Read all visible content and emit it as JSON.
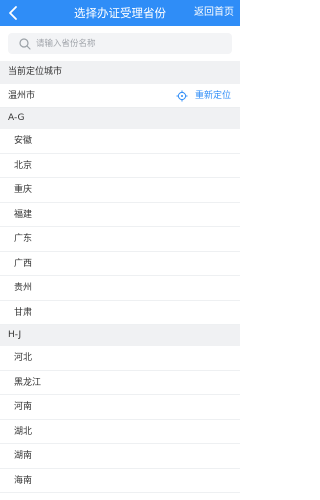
{
  "header": {
    "title": "选择办证受理省份",
    "home_label": "返回首页"
  },
  "search": {
    "placeholder": "请输入省份名称"
  },
  "location": {
    "section_title": "当前定位城市",
    "city": "温州市",
    "relocate_label": "重新定位"
  },
  "groups": [
    {
      "header": "A-G",
      "items": [
        "安徽",
        "北京",
        "重庆",
        "福建",
        "广东",
        "广西",
        "贵州",
        "甘肃"
      ]
    },
    {
      "header": "H-J",
      "items": [
        "河北",
        "黑龙江",
        "河南",
        "湖北",
        "湖南",
        "海南"
      ]
    }
  ],
  "colors": {
    "accent": "#2f8df7",
    "section_bg": "#f0f1f3"
  }
}
